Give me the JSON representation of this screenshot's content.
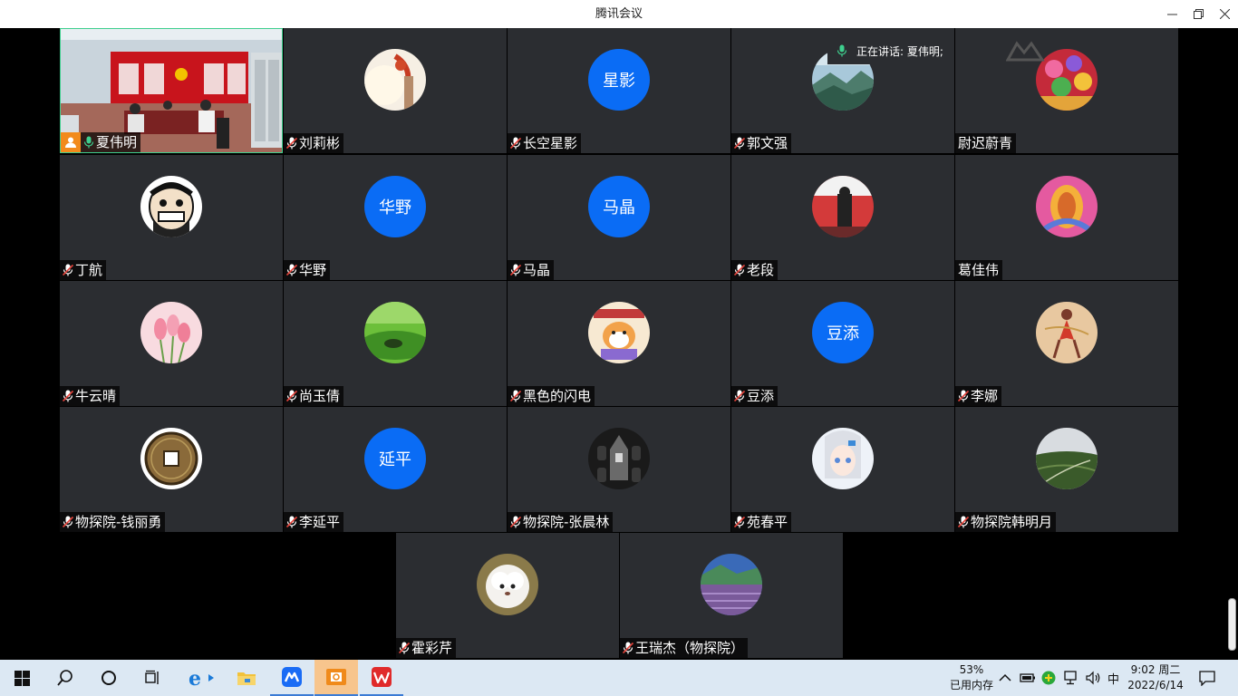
{
  "window": {
    "title": "腾讯会议"
  },
  "speaking": {
    "text": "正在讲话: 夏伟明;"
  },
  "participants": [
    {
      "name": "夏伟明"
    },
    {
      "name": "刘莉彬"
    },
    {
      "name": "长空星影",
      "initials": "星影"
    },
    {
      "name": "郭文强"
    },
    {
      "name": "尉迟蔚青"
    },
    {
      "name": "丁航"
    },
    {
      "name": "华野",
      "initials": "华野"
    },
    {
      "name": "马晶",
      "initials": "马晶"
    },
    {
      "name": "老段"
    },
    {
      "name": "葛佳伟"
    },
    {
      "name": "牛云晴"
    },
    {
      "name": "尚玉倩"
    },
    {
      "name": "黑色的闪电"
    },
    {
      "name": "豆添",
      "initials": "豆添"
    },
    {
      "name": "李娜"
    },
    {
      "name": "物探院-钱丽勇"
    },
    {
      "name": "李延平",
      "initials": "延平"
    },
    {
      "name": "物探院-张晨林"
    },
    {
      "name": "苑春平"
    },
    {
      "name": "物探院韩明月"
    },
    {
      "name": "霍彩芹"
    },
    {
      "name": "王瑞杰（物探院）"
    }
  ],
  "taskbar": {
    "memory_percent": "53%",
    "memory_label": "已用内存",
    "ime": "中",
    "time": "9:02 周二",
    "date": "2022/6/14"
  },
  "colors": {
    "accent": "#0a6cf5",
    "tile": "#2b2d31",
    "active_border": "#3ecf8e",
    "host_badge": "#f28a1b"
  }
}
